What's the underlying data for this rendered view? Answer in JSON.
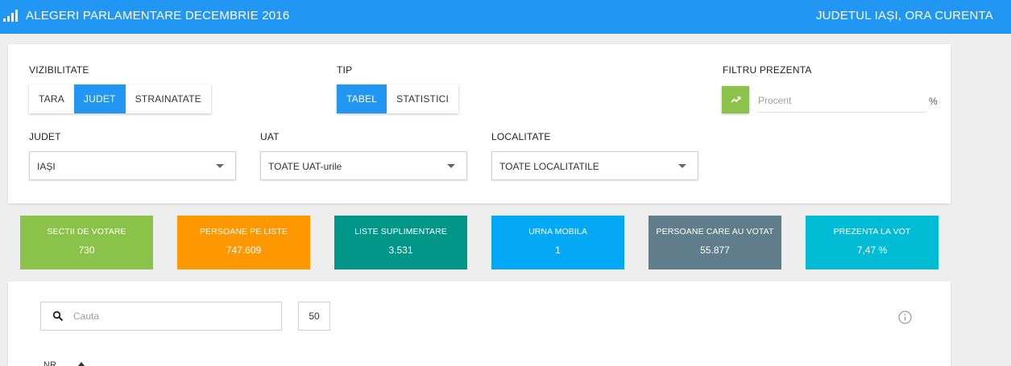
{
  "header": {
    "title": "ALEGERI PARLAMENTARE DECEMBRIE 2016",
    "right": "JUDETUL IAȘI, ORA CURENTA",
    "logo_icon": "bar-chart-icon"
  },
  "filters": {
    "visibility": {
      "label": "VIZIBILITATE",
      "options": [
        "TARA",
        "JUDET",
        "STRAINATATE"
      ],
      "selected": "JUDET"
    },
    "type": {
      "label": "TIP",
      "options": [
        "TABEL",
        "STATISTICI"
      ],
      "selected": "TABEL"
    },
    "presence": {
      "label": "FILTRU PREZENTA",
      "placeholder": "Procent",
      "unit": "%",
      "icon": "trending-up-icon"
    },
    "county": {
      "label": "JUDET",
      "value": "IAȘI"
    },
    "uat": {
      "label": "UAT",
      "value": "TOATE UAT-urile"
    },
    "locality": {
      "label": "LOCALITATE",
      "value": "TOATE LOCALITATILE"
    }
  },
  "stats": [
    {
      "title": "SECTII DE VOTARE",
      "value": "730",
      "color": "#8bc34a"
    },
    {
      "title": "PERSOANE PE LISTE",
      "value": "747.609",
      "color": "#ff9800"
    },
    {
      "title": "LISTE SUPLIMENTARE",
      "value": "3.531",
      "color": "#009688"
    },
    {
      "title": "URNA MOBILA",
      "value": "1",
      "color": "#03a9f4"
    },
    {
      "title": "PERSOANE CARE AU VOTAT",
      "value": "55.877",
      "color": "#607d8b"
    },
    {
      "title": "PREZENTA LA VOT",
      "value": "7,47 %",
      "color": "#00bcd4"
    }
  ],
  "table": {
    "search_placeholder": "Cauta",
    "page_size": "50",
    "first_column": "NR",
    "info_icon": "info-icon",
    "search_icon": "search-icon"
  },
  "colors": {
    "primary": "#2196f3",
    "accent_green": "#8bc34a"
  }
}
